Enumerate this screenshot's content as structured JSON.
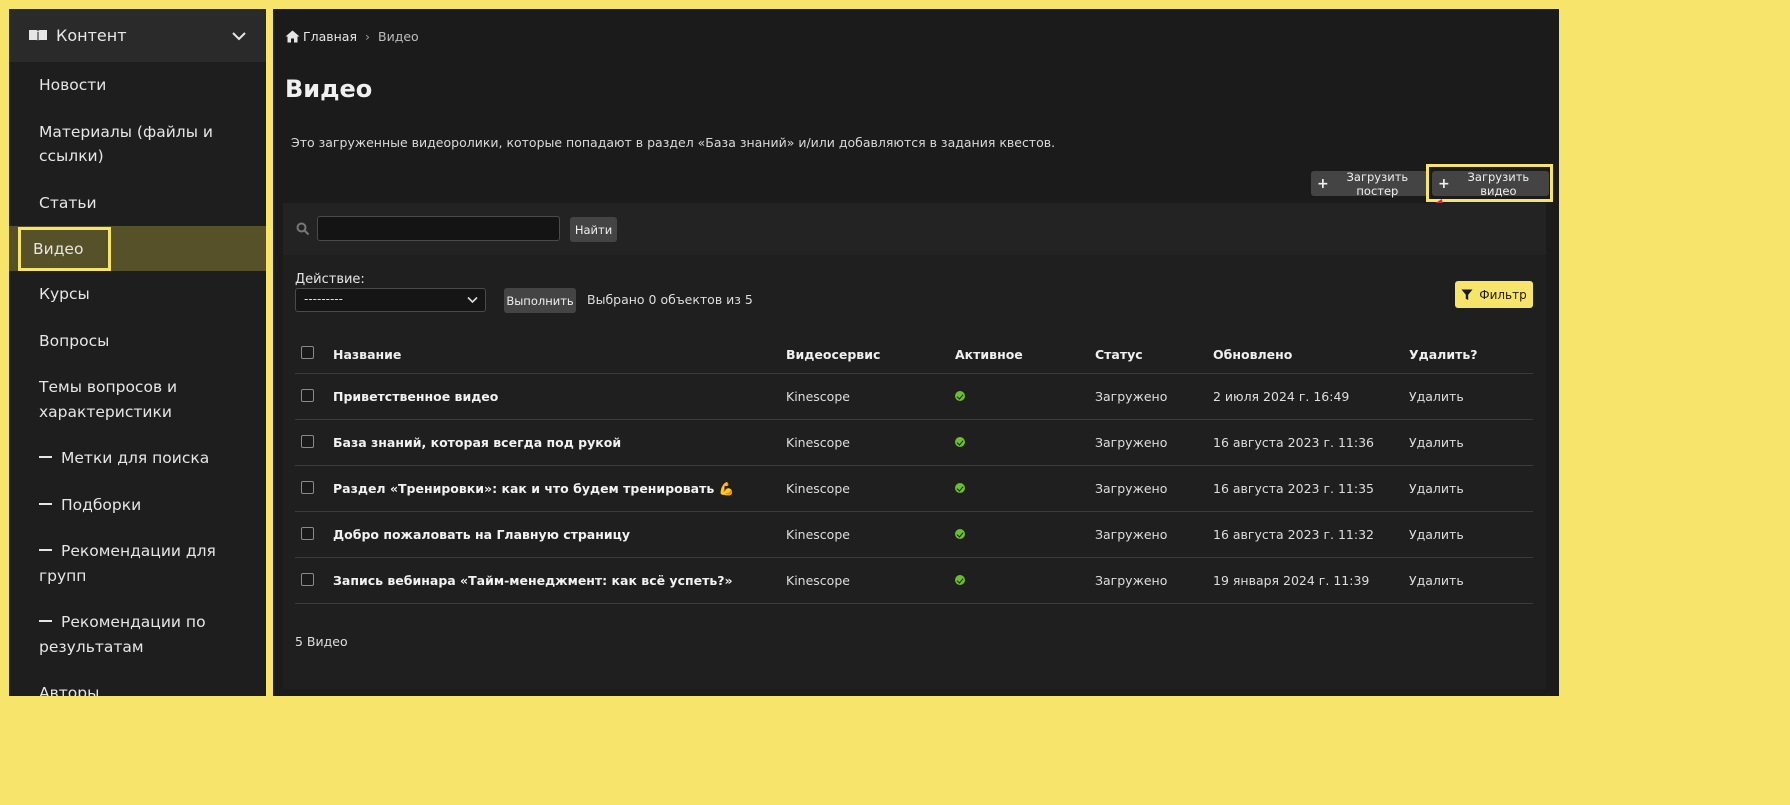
{
  "sidebar": {
    "section_title": "Контент",
    "items": [
      {
        "label": "Новости",
        "dash": false
      },
      {
        "label": "Материалы (файлы и ссылки)",
        "dash": false
      },
      {
        "label": "Статьи",
        "dash": false
      },
      {
        "label": "Видео",
        "dash": false,
        "active": true
      },
      {
        "label": "Курсы",
        "dash": false
      },
      {
        "label": "Вопросы",
        "dash": false
      },
      {
        "label": "Темы вопросов и характеристики",
        "dash": false
      },
      {
        "label": "Метки для поиска",
        "dash": true
      },
      {
        "label": "Подборки",
        "dash": true
      },
      {
        "label": "Рекомендации для групп",
        "dash": true
      },
      {
        "label": "Рекомендации по результатам",
        "dash": true
      },
      {
        "label": "Авторы",
        "dash": false
      }
    ]
  },
  "breadcrumb": {
    "home": "Главная",
    "separator": "›",
    "current": "Видео"
  },
  "page": {
    "title": "Видео",
    "description": "Это загруженные видеоролики, которые попадают в раздел «База знаний» и/или добавляются в задания квестов."
  },
  "toolbar": {
    "upload_poster": "Загрузить постер",
    "upload_video": "Загрузить видео",
    "plus": "+"
  },
  "search": {
    "value": "",
    "button": "Найти"
  },
  "actions": {
    "label": "Действие:",
    "selected": "---------",
    "run": "Выполнить",
    "selected_count": "Выбрано 0 объектов из 5",
    "filter": "Фильтр"
  },
  "table": {
    "headers": [
      "Название",
      "Видеосервис",
      "Активное",
      "Статус",
      "Обновлено",
      "Удалить?"
    ],
    "rows": [
      {
        "title": "Приветственное видео",
        "service": "Kinescope",
        "status": "Загружено",
        "updated": "2 июля 2024 г. 16:49",
        "delete": "Удалить"
      },
      {
        "title": "База знаний, которая всегда под рукой",
        "service": "Kinescope",
        "status": "Загружено",
        "updated": "16 августа 2023 г. 11:36",
        "delete": "Удалить"
      },
      {
        "title": "Раздел «Тренировки»: как и что будем тренировать 💪",
        "service": "Kinescope",
        "status": "Загружено",
        "updated": "16 августа 2023 г. 11:35",
        "delete": "Удалить"
      },
      {
        "title": "Добро пожаловать на Главную страницу",
        "service": "Kinescope",
        "status": "Загружено",
        "updated": "16 августа 2023 г. 11:32",
        "delete": "Удалить"
      },
      {
        "title": "Запись вебинара «Тайм-менеджмент: как всё успеть?»",
        "service": "Kinescope",
        "status": "Загружено",
        "updated": "19 января 2024 г. 11:39",
        "delete": "Удалить"
      }
    ]
  },
  "footer": {
    "count": "5 Видео"
  },
  "colors": {
    "accent": "#f6e46b",
    "active_bg": "#57512a",
    "active_dot": "#6abf2e",
    "arrow": "#d6284a"
  },
  "icons": {
    "section": "book-icon",
    "collapse": "chevron-down-icon",
    "home": "home-icon",
    "search": "search-icon",
    "filter": "filter-icon",
    "active": "check-circle-icon"
  }
}
